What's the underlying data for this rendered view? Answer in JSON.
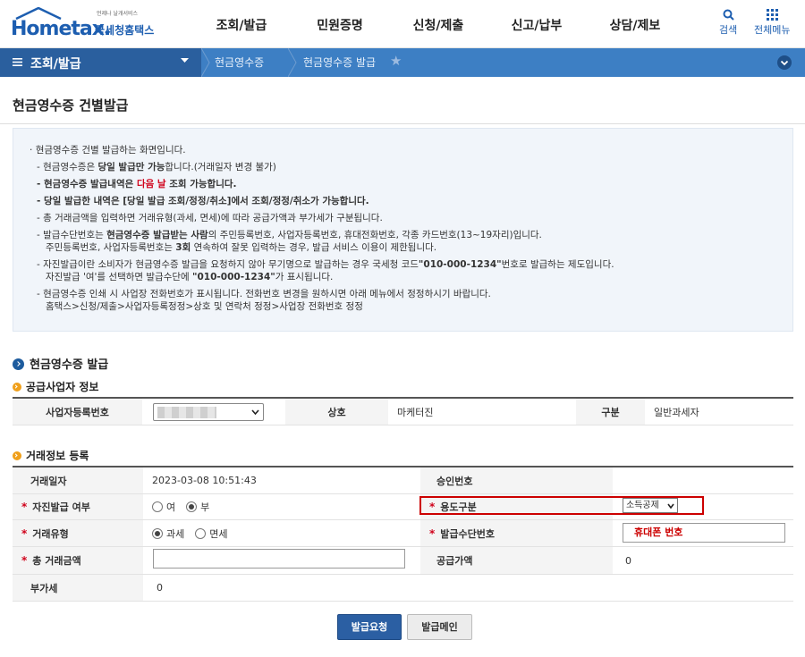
{
  "header": {
    "logo_main": "Hometax.",
    "logo_korean": "국세청홈택스",
    "logo_tagline": "언제나 날개서비스",
    "nav": [
      "조회/발급",
      "민원증명",
      "신청/제출",
      "신고/납부",
      "상담/제보"
    ],
    "search_label": "검색",
    "all_menu_label": "전체메뉴"
  },
  "subnav": {
    "section": "조회/발급",
    "crumb1": "현금영수증",
    "crumb2": "현금영수증 발급"
  },
  "page_title": "현금영수증 건별발급",
  "notice": {
    "intro": "현금영수증 건별 발급하는 화면입니다.",
    "l1_a": "현금영수증은 ",
    "l1_b": "당일 발급만 가능",
    "l1_c": "합니다.(거래일자 변경 불가)",
    "l2_a": "현금영수증 발급내역은 ",
    "l2_b": "다음 날",
    "l2_c": " 조회 가능합니다.",
    "l3": "당일 발급한 내역은 [당일 발급 조회/정정/취소]에서 조회/정정/취소가 가능합니다.",
    "l4": "총 거래금액을 입력하면 거래유형(과세, 면세)에 따라 공급가액과 부가세가 구분됩니다.",
    "l5_a": "발급수단번호는 ",
    "l5_b": "현금영수증 발급받는 사람",
    "l5_c": "의  주민등록번호, 사업자등록번호, 휴대전화번호, 각종 카드번호(13~19자리)입니다.",
    "l5_2a": "주민등록번호, 사업자등록번호는 ",
    "l5_2b": "3회",
    "l5_2c": " 연속하여 잘못 입력하는 경우, 발급 서비스 이용이 제한됩니다.",
    "l6_a": "자진발급이란 소비자가 현금영수증 발급을 요청하지 않아 무기명으로 발급하는 경우 국세청 코드",
    "l6_b": "\"010-000-1234\"",
    "l6_c": "번호로 발급하는 제도입니다.",
    "l6_2a": "자진발급 '여'를 선택하면 발급수단에 ",
    "l6_2b": "\"010-000-1234\"",
    "l6_2c": "가 표시됩니다.",
    "l7": "현금영수증 인쇄 시 사업장 전화번호가 표시됩니다. 전화번호 변경을 원하시면 아래 메뉴에서 정정하시기 바랍니다.",
    "l7_2": "홈택스>신청/제출>사업자등록정정>상호 및 연락처 정정>사업장 전화번호 정정"
  },
  "section_main": "현금영수증 발급",
  "supplier": {
    "title": "공급사업자 정보",
    "biz_no_label": "사업자등록번호",
    "name_label": "상호",
    "name_value": "마케터진",
    "type_label": "구분",
    "type_value": "일반과세자"
  },
  "transaction": {
    "title": "거래정보 등록",
    "date_label": "거래일자",
    "date_value": "2023-03-08 10:51:43",
    "approval_label": "승인번호",
    "self_issue_label": "자진발급 여부",
    "self_yes": "여",
    "self_no": "부",
    "usage_label": "용도구분",
    "usage_value": "소득공제",
    "type_label": "거래유형",
    "type_taxable": "과세",
    "type_exempt": "면세",
    "means_label": "발급수단번호",
    "means_value": "휴대폰 번호",
    "total_label": "총 거래금액",
    "supply_label": "공급가액",
    "supply_value": "0",
    "vat_label": "부가세",
    "vat_value": "0"
  },
  "buttons": {
    "request": "발급요청",
    "main": "발급메인"
  },
  "colors": {
    "brand": "#1d5eb0",
    "subnav": "#3d7fc4",
    "highlight": "#cc0000"
  }
}
